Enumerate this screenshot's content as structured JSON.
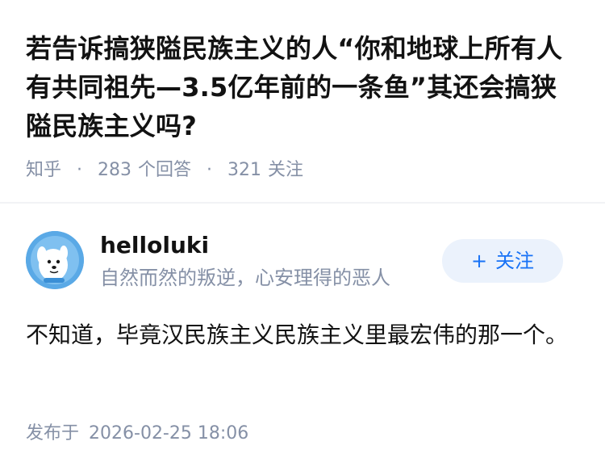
{
  "question": {
    "title": "若告诉搞狭隘民族主义的人“你和地球上所有人有共同祖先—3.5亿年前的一条鱼”其还会搞狭隘民族主义吗?",
    "source": "知乎",
    "answer_count": "283",
    "answer_label": "个回答",
    "follower_count": "321",
    "follower_label": "关注"
  },
  "answer": {
    "author": {
      "name": "helloluki",
      "bio": "自然而然的叛逆，心安理得的恶人",
      "avatar_icon": "puppy-avatar-icon"
    },
    "follow_button": {
      "icon": "+",
      "label": "关注"
    },
    "content": "不知道，毕竟汉民族主义民族主义里最宏伟的那一个。",
    "published_label": "发布于",
    "published_time": "2026-02-25 18:06"
  },
  "colors": {
    "primary_text": "#121212",
    "secondary_text": "#8590a6",
    "accent_blue": "#1772f6",
    "follow_button_bg": "#ebf2fc",
    "avatar_bg": "#5aa9e6"
  }
}
